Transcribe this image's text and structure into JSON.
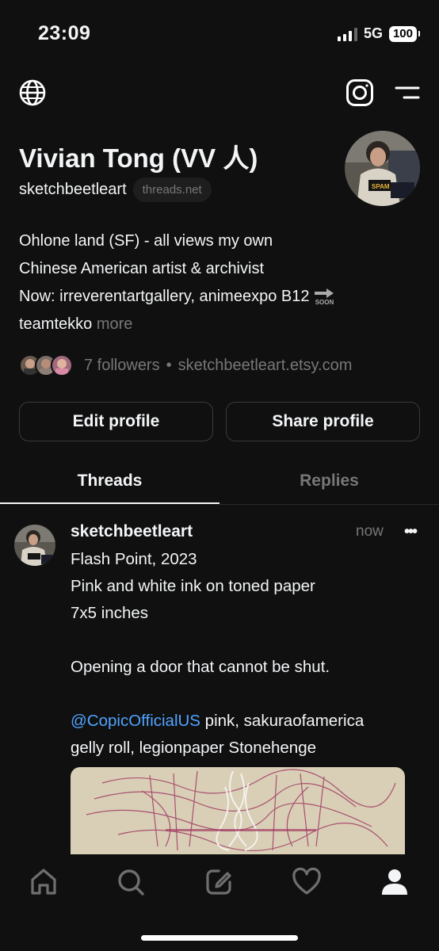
{
  "status_bar": {
    "time": "23:09",
    "network": "5G",
    "battery": "100"
  },
  "header_icons": [
    "globe-icon",
    "instagram-icon",
    "menu-icon"
  ],
  "profile": {
    "name": "Vivian Tong (VV 人)",
    "handle": "sketchbeetleart",
    "domain_badge": "threads.net",
    "bio_line1": "Ohlone land (SF) - all views my own",
    "bio_line2": "Chinese American artist & archivist",
    "bio_line3": "Now: irreverentartgallery, animeexpo B12",
    "bio_soon": "SOON",
    "bio_line4": "teamtekko",
    "bio_more": "more",
    "followers": "7 followers",
    "separator": "•",
    "website": "sketchbeetleart.etsy.com"
  },
  "buttons": {
    "edit": "Edit profile",
    "share": "Share profile"
  },
  "tabs": {
    "threads": "Threads",
    "replies": "Replies"
  },
  "post": {
    "username": "sketchbeetleart",
    "time": "now",
    "more": "•••",
    "line1": "Flash Point, 2023",
    "line2": "Pink and white ink on toned paper",
    "line3": "7x5 inches",
    "line4": "Opening a door that cannot be shut.",
    "mention": "@CopicOfficialUS",
    "line5_rest": " pink, sakuraofamerica",
    "line6": "gelly roll, legionpaper Stonehenge"
  },
  "bottom_nav": [
    "home-icon",
    "search-icon",
    "compose-icon",
    "heart-icon",
    "profile-icon"
  ],
  "colors": {
    "background": "#101010",
    "text": "#f3f5f7",
    "muted": "#777777",
    "link": "#4fa3ff"
  }
}
